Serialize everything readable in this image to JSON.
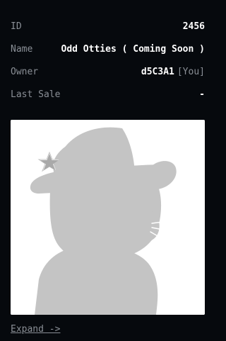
{
  "details": {
    "id_label": "ID",
    "id_value": "2456",
    "name_label": "Name",
    "name_value": "Odd Otties ( Coming Soon )",
    "owner_label": "Owner",
    "owner_value": "d5C3A1",
    "owner_tag": "[You]",
    "last_sale_label": "Last Sale",
    "last_sale_value": "-"
  },
  "image": {
    "placeholder_icon": "otter-wizard-silhouette",
    "silhouette_color": "#c4c4c4",
    "background_color": "#ffffff"
  },
  "expand_label": "Expand ->"
}
